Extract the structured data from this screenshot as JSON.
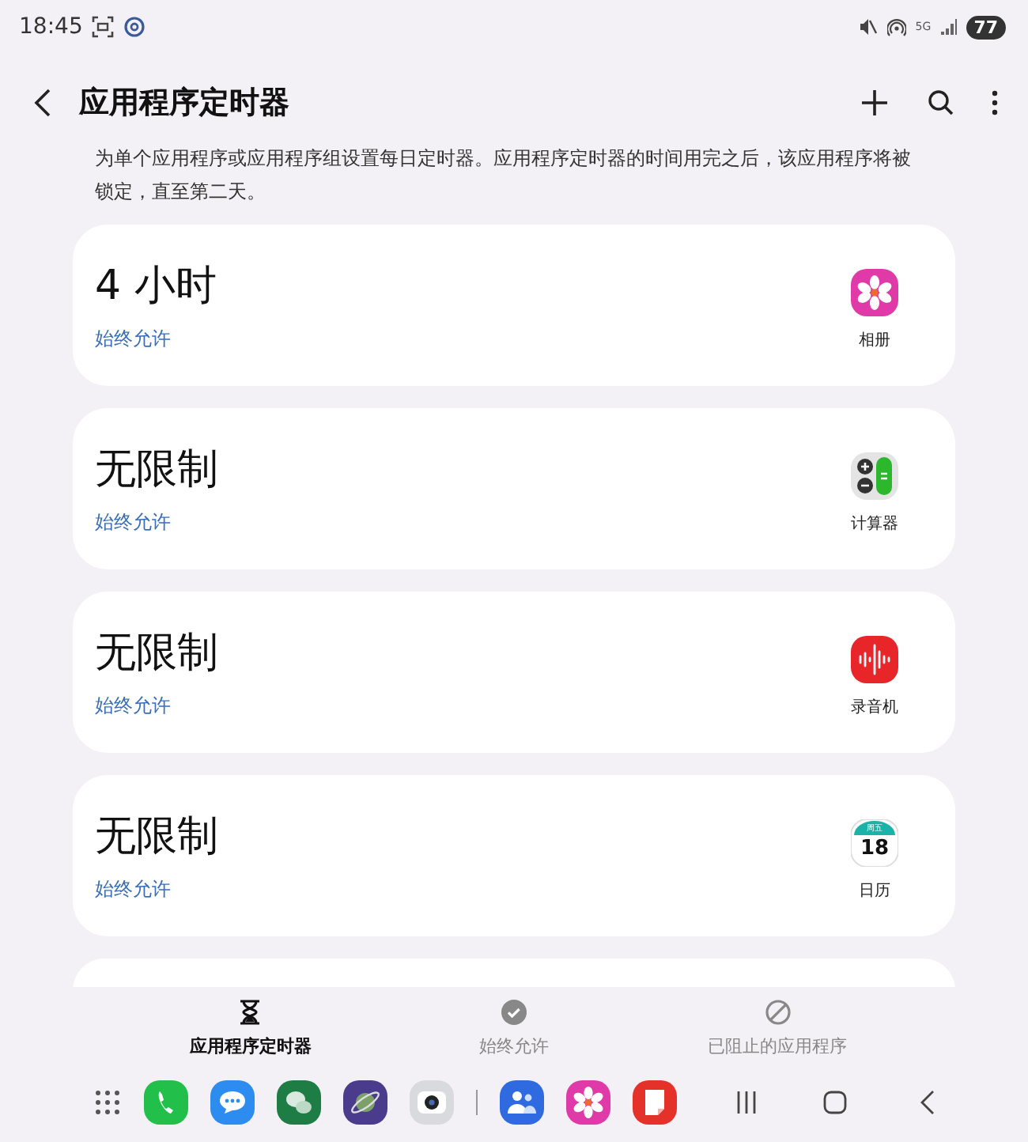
{
  "status_bar": {
    "time": "18:45",
    "network": "5G",
    "battery": "77"
  },
  "header": {
    "title": "应用程序定时器",
    "description": "为单个应用程序或应用程序组设置每日定时器。应用程序定时器的时间用完之后，该应用程序将被锁定，直至第二天。"
  },
  "apps": [
    {
      "timer": "4 小时",
      "status": "始终允许",
      "name": "相册",
      "kind": "flower"
    },
    {
      "timer": "无限制",
      "status": "始终允许",
      "name": "计算器",
      "kind": "calculator"
    },
    {
      "timer": "无限制",
      "status": "始终允许",
      "name": "录音机",
      "kind": "recorder"
    },
    {
      "timer": "无限制",
      "status": "始终允许",
      "name": "日历",
      "kind": "calendar",
      "icon_weekday": "周五",
      "icon_date": "18"
    }
  ],
  "tabs": [
    {
      "label": "应用程序定时器",
      "kind": "hourglass",
      "selected": true
    },
    {
      "label": "始终允许",
      "kind": "check",
      "selected": false
    },
    {
      "label": "已阻止的应用程序",
      "kind": "block",
      "selected": false
    }
  ],
  "dock": [
    {
      "kind": "grid"
    },
    {
      "kind": "phone"
    },
    {
      "kind": "chat"
    },
    {
      "kind": "wechat"
    },
    {
      "kind": "planet"
    },
    {
      "kind": "camera"
    },
    {
      "kind": "divider"
    },
    {
      "kind": "people"
    },
    {
      "kind": "flower"
    },
    {
      "kind": "notes"
    },
    {
      "kind": "recents"
    },
    {
      "kind": "home"
    },
    {
      "kind": "back"
    }
  ]
}
